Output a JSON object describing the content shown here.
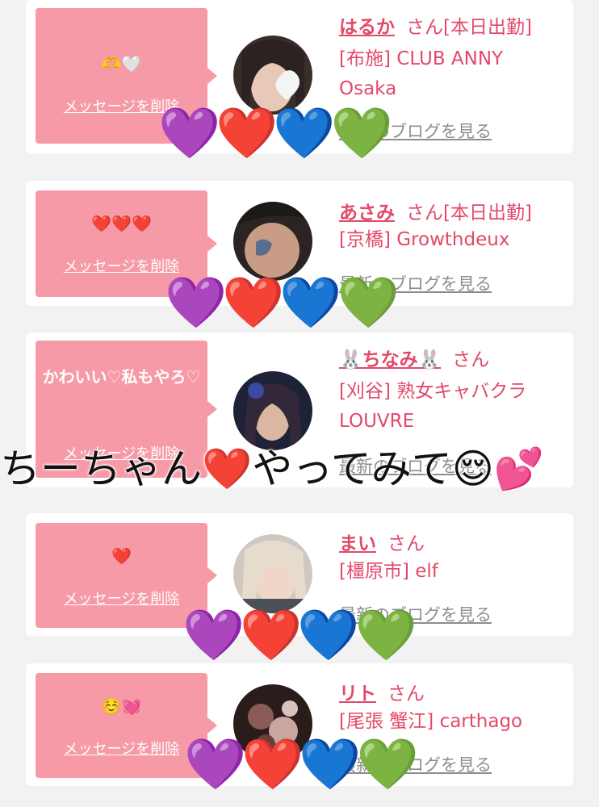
{
  "cards": [
    {
      "message": "🫶🤍",
      "delete_label": "メッセージを削除",
      "name": "はるか",
      "san": "さん",
      "status": "[本日出勤]",
      "info": "[布施] CLUB ANNY Osaka",
      "blog": "最新のブログを見る"
    },
    {
      "message": "❤️❤️❤️",
      "delete_label": "メッセージを削除",
      "name": "あさみ",
      "san": "さん",
      "status": "[本日出勤]",
      "info": "[京橋] Growthdeux",
      "blog": "最新のブログを見る"
    },
    {
      "message": "かわいい♡私もやろ♡",
      "delete_label": "メッセージを削除",
      "name": "🐰ちなみ🐰",
      "san": "さん",
      "status": "",
      "info": "[刈谷] 熟女キャバクラ LOUVRE",
      "blog": "最新のブログを見る"
    },
    {
      "message": "❤️",
      "delete_label": "メッセージを削除",
      "name": "まい",
      "san": "さん",
      "status": "",
      "info": "[橿原市] elf",
      "blog": "最新のブログを見る"
    },
    {
      "message": "☺️💓",
      "delete_label": "メッセージを削除",
      "name": "リト",
      "san": "さん",
      "status": "",
      "info": "[尾張 蟹江] carthago",
      "blog": "最新のブログを見る"
    }
  ],
  "overlay_caption": "ちーちゃん❤️やってみて😌💕",
  "hearts": [
    "💜",
    "❤️",
    "💙",
    "💚"
  ],
  "colors": {
    "accent": "#e34968",
    "bubble": "#f79aa7",
    "background": "#f2f2f2"
  }
}
